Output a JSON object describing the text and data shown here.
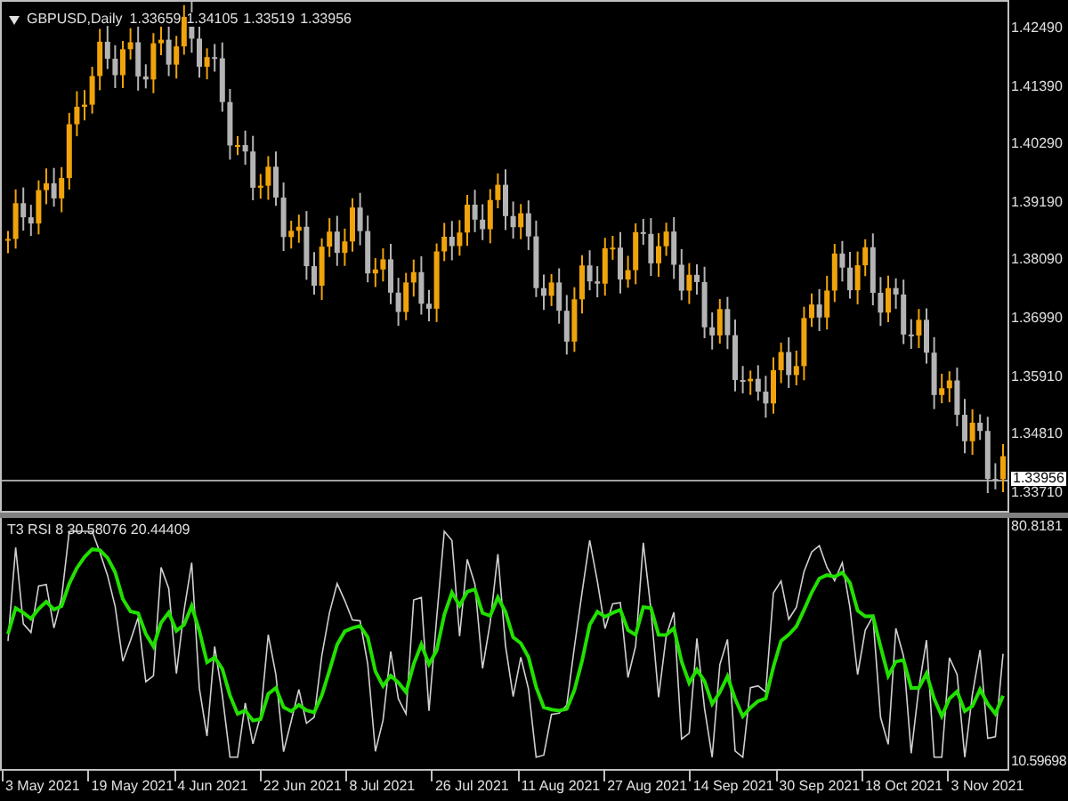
{
  "main_pane": {
    "symbol": "GBPUSD,Daily",
    "ohlc": [
      "1.33659",
      "1.34105",
      "1.33519",
      "1.33956"
    ],
    "price_axis": [
      "1.42490",
      "1.41390",
      "1.40290",
      "1.39190",
      "1.38090",
      "1.36990",
      "1.35910",
      "1.34810",
      "1.33710"
    ],
    "current_price": "1.33956"
  },
  "indicator_pane": {
    "label": "T3 RSI 8 30.58076 20.44409",
    "axis": [
      "80.8181",
      "10.59698"
    ]
  },
  "time_axis": [
    "3 May 2021",
    "19 May 2021",
    "4 Jun 2021",
    "22 Jun 2021",
    "8 Jul 2021",
    "26 Jul 2021",
    "11 Aug 2021",
    "27 Aug 2021",
    "14 Sep 2021",
    "30 Sep 2021",
    "18 Oct 2021",
    "3 Nov 2021"
  ]
}
